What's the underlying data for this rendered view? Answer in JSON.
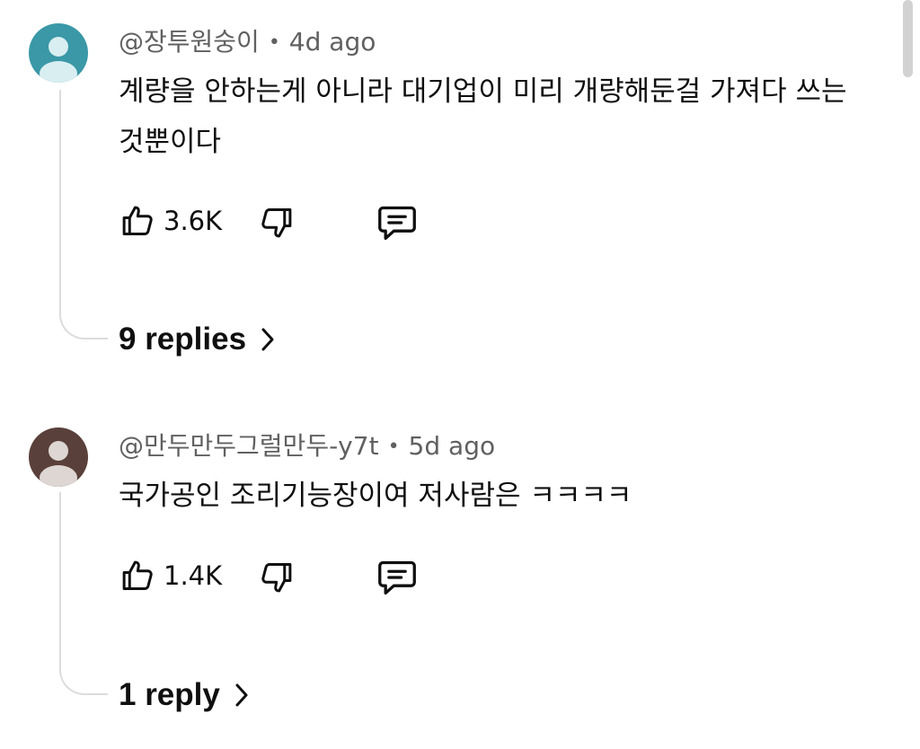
{
  "comments": [
    {
      "author": "@장투원숭이",
      "time": "4d ago",
      "text": "계량을 안하는게 아니라 대기업이 미리 개량해둔걸 가져다 쓰는것뿐이다",
      "likes": "3.6K",
      "replies_label": "9 replies",
      "avatar_color": "#3a98a7",
      "icons": {
        "like": "thumbs-up-icon",
        "dislike": "thumbs-down-icon",
        "reply": "comment-icon",
        "expand": "chevron-right-icon"
      }
    },
    {
      "author": "@만두만두그럴만두-y7t",
      "time": "5d ago",
      "text": "국가공인 조리기능장이여 저사람은 ㅋㅋㅋㅋ",
      "likes": "1.4K",
      "replies_label": "1 reply",
      "avatar_color": "#5a403a",
      "icons": {
        "like": "thumbs-up-icon",
        "dislike": "thumbs-down-icon",
        "reply": "comment-icon",
        "expand": "chevron-right-icon"
      }
    }
  ],
  "separator": "•"
}
